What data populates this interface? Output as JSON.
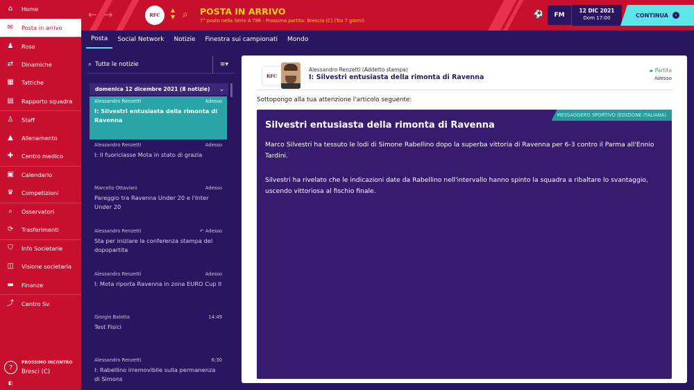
{
  "sidebar": {
    "items": [
      {
        "label": "Home",
        "icon": "home-icon"
      },
      {
        "label": "Posta in arrivo",
        "icon": "inbox-icon"
      },
      {
        "label": "Rosa",
        "icon": "squad-icon"
      },
      {
        "label": "Dinamiche",
        "icon": "dynamics-icon"
      },
      {
        "label": "Tattiche",
        "icon": "tactics-icon"
      },
      {
        "label": "Rapporto squadra",
        "icon": "report-icon"
      },
      {
        "label": "Staff",
        "icon": "staff-icon"
      },
      {
        "label": "Allenamento",
        "icon": "training-icon"
      },
      {
        "label": "Centro medico",
        "icon": "medical-icon"
      },
      {
        "label": "Calendario",
        "icon": "calendar-icon"
      },
      {
        "label": "Competizioni",
        "icon": "trophy-icon"
      },
      {
        "label": "Osservatori",
        "icon": "scout-icon"
      },
      {
        "label": "Trasferimenti",
        "icon": "transfers-icon"
      },
      {
        "label": "Info Societarie",
        "icon": "club-info-icon"
      },
      {
        "label": "Visione societaria",
        "icon": "club-vision-icon"
      },
      {
        "label": "Finanze",
        "icon": "finances-icon"
      },
      {
        "label": "Centro Sv.",
        "icon": "dev-centre-icon"
      }
    ],
    "next_match": {
      "days": "7",
      "label": "PROSSIMO INCONTRO",
      "opponent": "Bresci (C)"
    }
  },
  "header": {
    "crest": "RFC",
    "title": "POSTA IN ARRIVO",
    "subtitle": "7° posto nella Serie A TIM - Prossima partita: Brescia (C) (Tra 7 giorni)",
    "fm_badge": "FM",
    "date": "12 DIC 2021",
    "time": "Dom 17:00",
    "continue_label": "CONTINUA"
  },
  "tabs": [
    "Posta",
    "Social Network",
    "Notizie",
    "Finestra sui campionati",
    "Mondo"
  ],
  "inbox": {
    "filter_label": "Tutte le notizie",
    "group_label": "domenica 12 dicembre 2021 (8 notizie)",
    "items": [
      {
        "from": "Alessandro Renzetti",
        "time": "Adesso",
        "subject": "I: Silvestri entusiasta della rimonta di Ravenna",
        "selected": true
      },
      {
        "from": "Alessandro Renzetti",
        "time": "Adesso",
        "subject": "I: Il fuoriclasse Mota in stato di grazia"
      },
      {
        "from": "Marcello Ottaviani",
        "time": "Adesso",
        "subject": "Pareggio tra Ravenna Under 20 e l'Inter Under 20"
      },
      {
        "from": "Alessandro Renzetti",
        "time": "Adesso",
        "subject": "Sta per iniziare la conferenza stampa del dopopartita",
        "replied": true
      },
      {
        "from": "Alessandro Renzetti",
        "time": "Adesso",
        "subject": "I: Mota riporta Ravenna in zona EURO Cup II"
      },
      {
        "from": "Giorgio Balotta",
        "time": "14:49",
        "subject": "Test Fisici"
      },
      {
        "from": "Alessandro Renzetti",
        "time": "6:30",
        "subject": "I: Rabellino irremovibile sulla permanenza di Simons"
      }
    ]
  },
  "message": {
    "sender": "Alessandro Renzetti  (Addetto stampa)",
    "title": "I: Silvestri entusiasta della rimonta di Ravenna",
    "tag": "Partita",
    "role": "Adesso",
    "intro": "Sottopongo alla tua attenzione l'articolo seguente:",
    "source": "MESSAGGERO SPORTIVO (EDIZIONE ITALIANA)",
    "article_title": "Silvestri entusiasta della rimonta di Ravenna",
    "para1": "Marco Silvestri ha tessuto le lodi di Simone Rabellino dopo la superba vittoria di Ravenna per 6-3 contro il Parma all'Ennio Tardini.",
    "para2": "Silvestri ha rivelato che le indicazioni date da Rabellino nell'intervallo hanno spinto la squadra a ribaltare lo svantaggio, uscendo vittoriosa al fischio finale."
  },
  "colors": {
    "brand_red": "#c8102e",
    "purple": "#2a1660",
    "accent_cyan": "#5de6ea",
    "teal": "#29a5a8",
    "yellow": "#ffc926"
  }
}
